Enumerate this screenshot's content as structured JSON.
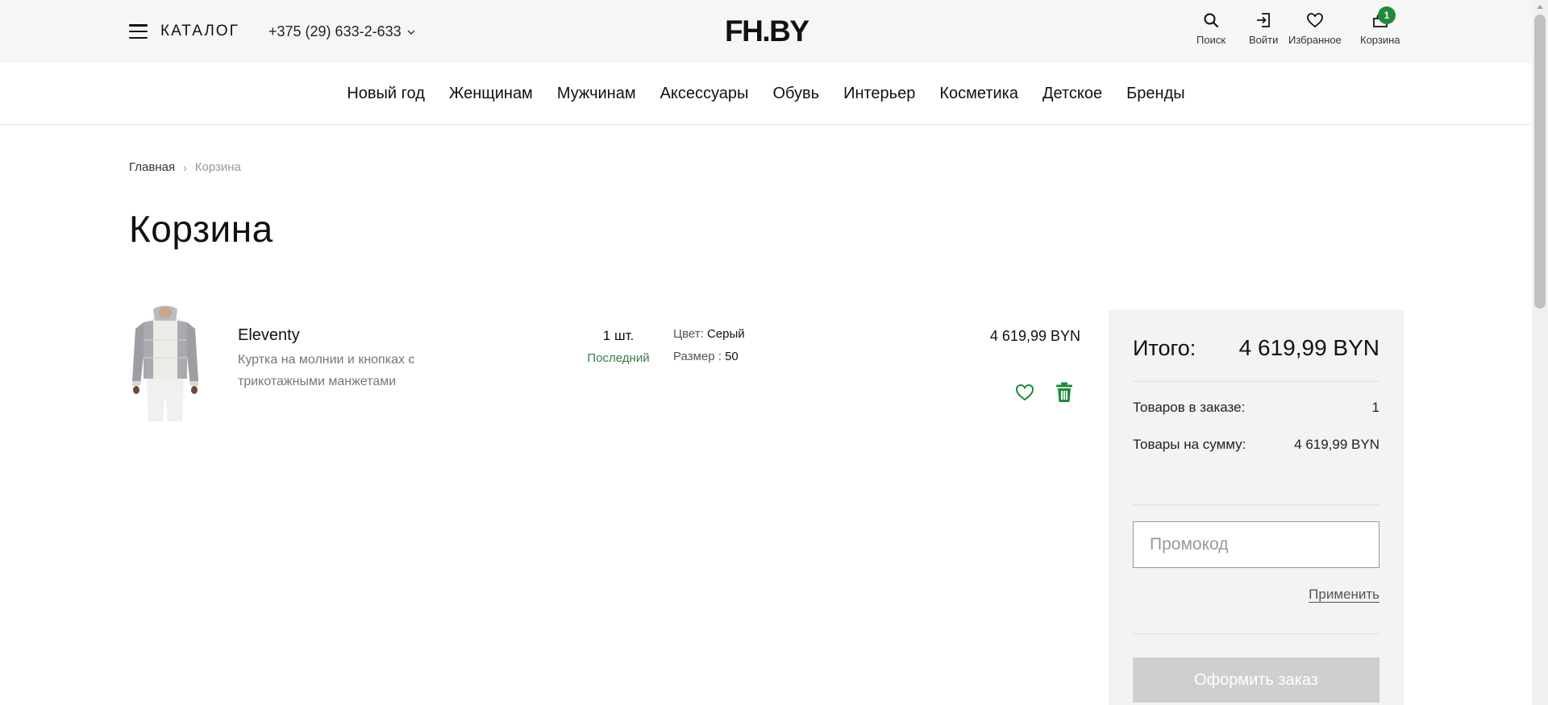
{
  "header": {
    "catalog_label": "КАТАЛОГ",
    "phone": "+375 (29) 633-2-633",
    "logo": "FH.BY",
    "icons": {
      "search_label": "Поиск",
      "login_label": "Войти",
      "favorites_label": "Избранное",
      "cart_label": "Корзина",
      "cart_count": "1"
    }
  },
  "nav": {
    "items": [
      "Новый год",
      "Женщинам",
      "Мужчинам",
      "Аксессуары",
      "Обувь",
      "Интерьер",
      "Косметика",
      "Детское",
      "Бренды"
    ]
  },
  "breadcrumb": {
    "home": "Главная",
    "current": "Корзина"
  },
  "page_title": "Корзина",
  "cart_item": {
    "brand": "Eleventy",
    "description": "Куртка на молнии и кнопках с трикотажными манжетами",
    "quantity": "1 шт.",
    "stock_note": "Последний",
    "color_label": "Цвет:",
    "color_value": "Серый",
    "size_label": "Размер :",
    "size_value": "50",
    "price": "4 619,99 BYN"
  },
  "summary": {
    "total_label": "Итого:",
    "total_value": "4 619,99 BYN",
    "items_count_label": "Товаров в заказе:",
    "items_count_value": "1",
    "goods_sum_label": "Товары на сумму:",
    "goods_sum_value": "4 619,99 BYN",
    "promo_placeholder": "Промокод",
    "apply_label": "Применить",
    "checkout_label": "Оформить заказ"
  },
  "colors": {
    "accent_green": "#1f8a3a",
    "header_bg": "#f6f6f6",
    "summary_bg": "#f3f3f3",
    "checkout_disabled": "#cfcfcf"
  }
}
